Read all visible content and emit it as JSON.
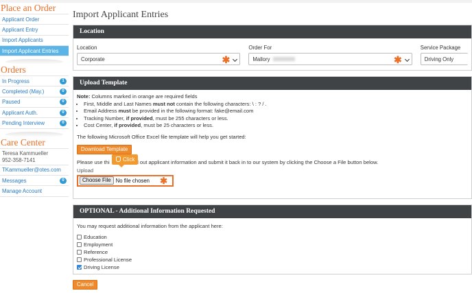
{
  "sidebar": {
    "place_order": {
      "title": "Place an Order",
      "items": [
        "Applicant Order",
        "Applicant Entry",
        "Import Applicants",
        "Import Applicant Entries"
      ]
    },
    "orders": {
      "title": "Orders",
      "items": [
        {
          "label": "In Progress",
          "count": "1"
        },
        {
          "label": "Completed (May.)",
          "count": "0"
        },
        {
          "label": "Paused",
          "count": "0"
        },
        {
          "label": "Applicant Auth.",
          "count": "0"
        },
        {
          "label": "Pending Interview",
          "count": "0"
        }
      ]
    },
    "care_center": {
      "title": "Care Center",
      "contact_name": "Teresa Kammueller",
      "phone": "952-358-7141",
      "email": "TKammueller@otes.com",
      "messages_label": "Messages",
      "messages_count": "0",
      "manage_account": "Manage Account"
    }
  },
  "main": {
    "title": "Import Applicant Entries",
    "location_panel": {
      "heading": "Location",
      "location_label": "Location",
      "location_value": "Corporate",
      "order_for_label": "Order For",
      "order_for_value": "Mallory",
      "service_package_label": "Service Package",
      "service_package_value": "Driving Only"
    },
    "upload_panel": {
      "heading": "Upload Template",
      "note_strong": "Note:",
      "note_text": " Columns marked in orange are required fields",
      "bullets": [
        {
          "a": "First, Middle and Last Names ",
          "b": "must not",
          "c": " contain the following characters: \\ : ? / ."
        },
        {
          "a": "Email Address ",
          "b": "must",
          "c": " be provided in the following format: fake@email.com"
        },
        {
          "a": "Tracking Number, ",
          "b": "if provided",
          "c": ", must be 255 characters or less."
        },
        {
          "a": "Cost Center, ",
          "b": "if provided",
          "c": ", must be 25 characters or less."
        }
      ],
      "template_text": "The following Microsoft Office Excel file template will help you get started:",
      "download_button": "Download Template",
      "instructions_start": "Please use thi",
      "instructions_end": "ill out applicant information and submit it back in to our system by clicking the Choose a File button below.",
      "upload_label": "Upload",
      "choose_file_button": "Choose File",
      "no_file_text": "No file chosen",
      "callout_text": "Click"
    },
    "optional_panel": {
      "heading": "OPTIONAL - Additional Information Requested",
      "intro": "You may request additional information from the applicant here:",
      "options": [
        {
          "label": "Education",
          "checked": false
        },
        {
          "label": "Employment",
          "checked": false
        },
        {
          "label": "Reference",
          "checked": false
        },
        {
          "label": "Professional License",
          "checked": false
        },
        {
          "label": "Driving License",
          "checked": true
        }
      ]
    },
    "cancel_button": "Cancel"
  },
  "colors": {
    "accent": "#e8702a",
    "panel_header": "#3f4346",
    "link": "#2b7bbf",
    "active_nav": "#5bb4e6",
    "badge": "#2f9ad6"
  }
}
